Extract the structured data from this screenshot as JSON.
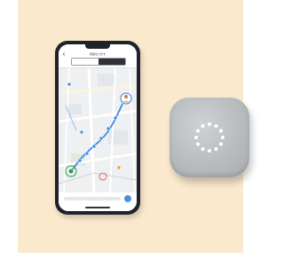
{
  "phone": {
    "app_title": "家族をさがす",
    "segment_tabs": [
      "",
      ""
    ],
    "colors": {
      "route": "#2f7fe0",
      "route_dot": "#3a8ee6",
      "start_marker": "#2e9d4a",
      "map_bg": "#eef0f2",
      "road": "#ffffff"
    }
  },
  "device": {
    "colors": {
      "body": "#babdc0",
      "leds": "#ffffff"
    },
    "led_count": 12
  }
}
